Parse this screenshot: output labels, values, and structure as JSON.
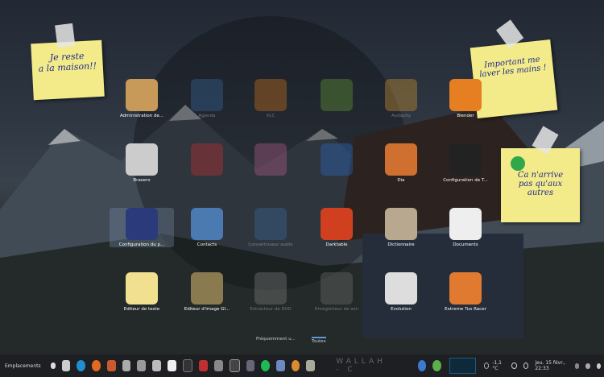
{
  "notes": {
    "left": "Je reste\na la maison!!",
    "right_top": "Important me\nlaver les mains !",
    "right_bottom": "Ca n'arrive\npas qu'aux\nautres"
  },
  "apps": [
    {
      "label": "Administration de...",
      "color": "#c89a5a",
      "faded": false
    },
    {
      "label": "Agenda",
      "color": "#3a6ea5",
      "faded": true
    },
    {
      "label": "VLC",
      "color": "#e07a1a",
      "faded": true
    },
    {
      "label": "",
      "color": "#6ca534",
      "faded": true
    },
    {
      "label": "Audacity",
      "color": "#e0a030",
      "faded": true
    },
    {
      "label": "Blender",
      "color": "#e67e22",
      "faded": false
    },
    {
      "label": "Brasero",
      "color": "#cccccc",
      "faded": false
    },
    {
      "label": "",
      "color": "#d03030",
      "faded": true
    },
    {
      "label": "",
      "color": "#c06090",
      "faded": true
    },
    {
      "label": "",
      "color": "#2a6fcf",
      "faded": true
    },
    {
      "label": "Dia",
      "color": "#d07030",
      "faded": false
    },
    {
      "label": "Configuration de T...",
      "color": "#222222",
      "faded": false
    },
    {
      "label": "Configuration du p...",
      "color": "#2a3a7a",
      "faded": false,
      "selected": true
    },
    {
      "label": "Contacts",
      "color": "#4a7ab0",
      "faded": false
    },
    {
      "label": "Convertisseur audio",
      "color": "#3a6ea5",
      "faded": true
    },
    {
      "label": "Darktable",
      "color": "#d04020",
      "faded": false
    },
    {
      "label": "Dictionnaire",
      "color": "#b8a890",
      "faded": false
    },
    {
      "label": "Documents",
      "color": "#eeeeee",
      "faded": false
    },
    {
      "label": "Éditeur de texte",
      "color": "#f0e090",
      "faded": false
    },
    {
      "label": "Éditeur d'image GI...",
      "color": "#8a7a50",
      "faded": false
    },
    {
      "label": "Extracteur de DVD",
      "color": "#888888",
      "faded": true
    },
    {
      "label": "Enregistreur de son",
      "color": "#777777",
      "faded": true
    },
    {
      "label": "Evolution",
      "color": "#dddddd",
      "faded": false
    },
    {
      "label": "Extreme Tux Racer",
      "color": "#e07a30",
      "faded": false
    }
  ],
  "tabs": [
    "Fréquemment u...",
    "Toutes"
  ],
  "taskbar": {
    "places": "Emplacements",
    "brand": "WALLAH - C",
    "temp": "-1,1 °C",
    "datetime": "jeu. 15 févr., 22:33"
  }
}
